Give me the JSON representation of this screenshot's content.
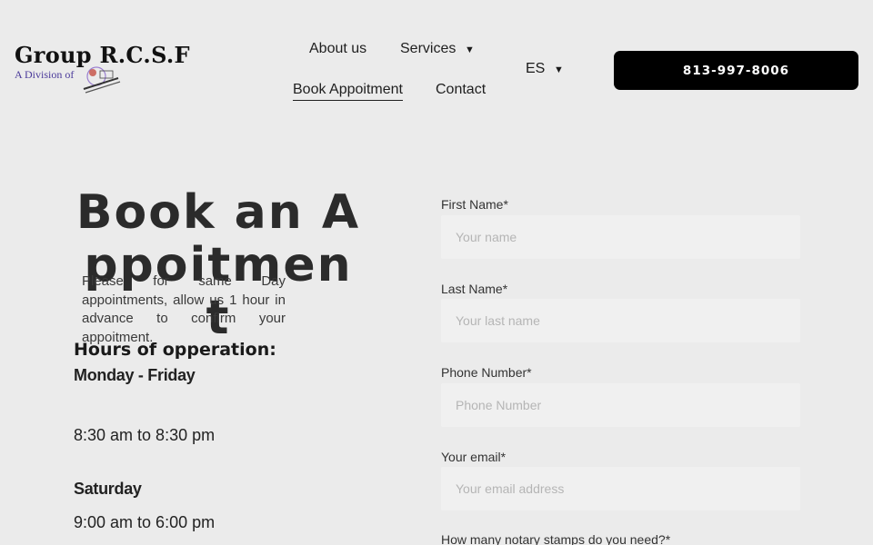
{
  "brand": {
    "title": "Group R.C.S.F",
    "subtitle": "A Division of"
  },
  "nav": {
    "about": "About us",
    "services": "Services",
    "book": "Book Appoitment",
    "contact": "Contact",
    "language": "ES"
  },
  "phone_button": "813-997-8006",
  "hero": {
    "title": "Book an Appoitment",
    "intro": "Please for same Day appointments, allow us 1 hour in advance to confirm your appoitment."
  },
  "hours": {
    "title": "Hours of opperation:",
    "weekday_label": "Monday - Friday",
    "weekday_hours": "8:30 am to 8:30 pm",
    "saturday_label": "Saturday",
    "saturday_hours": "9:00 am to 6:00 pm"
  },
  "form": {
    "first_name": {
      "label": "First Name*",
      "placeholder": "Your name"
    },
    "last_name": {
      "label": "Last Name*",
      "placeholder": "Your last name"
    },
    "phone": {
      "label": "Phone Number*",
      "placeholder": "Phone Number"
    },
    "email": {
      "label": "Your email*",
      "placeholder": "Your email address"
    },
    "stamps_label": "How many notary stamps do you need?*"
  },
  "colors": {
    "background": "#ebebeb",
    "button": "#000000",
    "input_bg": "#f0f0f0"
  },
  "icons": {
    "dropdown": "caret-down-icon",
    "logo": "logo-mark-icon"
  }
}
